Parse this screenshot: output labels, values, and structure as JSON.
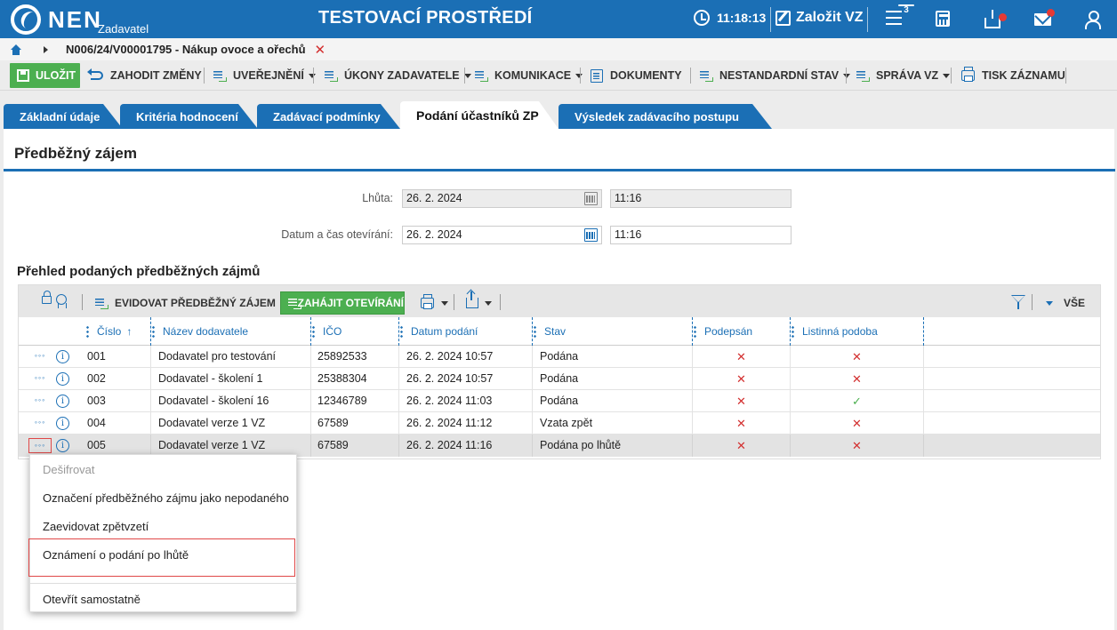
{
  "header": {
    "logo_text": "NEN",
    "logo_sub": "Zadavatel",
    "environment_title": "TESTOVACÍ PROSTŘEDÍ",
    "clock": "11:18:13",
    "create_vz_label": "Založit VZ",
    "notifications_count": "3",
    "colors": {
      "primary": "#1b6fb5",
      "badge": "#e53935"
    }
  },
  "breadcrumb": {
    "path": "N006/24/V00001795 - Nákup ovoce a ořechů"
  },
  "toolbar": {
    "save": "ULOŽIT",
    "discard": "ZAHODIT ZMĚNY",
    "publish": "UVEŘEJNĚNÍ",
    "actions": "ÚKONY ZADAVATELE",
    "communication": "KOMUNIKACE",
    "documents": "DOKUMENTY",
    "nonstandard": "NESTANDARDNÍ STAV",
    "management": "SPRÁVA VZ",
    "print": "TISK ZÁZNAMU"
  },
  "tabs": [
    {
      "label": "Základní údaje",
      "active": false
    },
    {
      "label": "Kritéria hodnocení",
      "active": false
    },
    {
      "label": "Zadávací podmínky",
      "active": false
    },
    {
      "label": "Podání účastníků ZP",
      "active": true
    },
    {
      "label": "Výsledek zadávacího postupu",
      "active": false
    }
  ],
  "panel": {
    "title": "Předběžný zájem",
    "deadline_label": "Lhůta:",
    "deadline_date": "26. 2. 2024",
    "deadline_time": "11:16",
    "opening_label": "Datum a čas otevírání:",
    "opening_date": "26. 2. 2024",
    "opening_time": "11:16"
  },
  "grid": {
    "title": "Přehled podaných předběžných zájmů",
    "toolbar": {
      "register": "EVIDOVAT PŘEDBĚŽNÝ ZÁJEM",
      "start_opening": "ZAHÁJIT OTEVÍRÁNÍ",
      "all": "VŠE"
    },
    "columns": {
      "number": "Číslo",
      "supplier": "Název dodavatele",
      "ico": "IČO",
      "date": "Datum podání",
      "state": "Stav",
      "signed": "Podepsán",
      "paper": "Listinná podoba"
    },
    "more_glyph": "◦◦◦",
    "info_glyph": "i",
    "rows": [
      {
        "number": "001",
        "supplier": "Dodavatel pro testování",
        "ico": "25892533",
        "date": "26. 2. 2024 10:57",
        "state": "Podána",
        "signed": "✕",
        "paper": "✕"
      },
      {
        "number": "002",
        "supplier": "Dodavatel - školení 1",
        "ico": "25388304",
        "date": "26. 2. 2024 10:57",
        "state": "Podána",
        "signed": "✕",
        "paper": "✕"
      },
      {
        "number": "003",
        "supplier": "Dodavatel - školení 16",
        "ico": "12346789",
        "date": "26. 2. 2024 11:03",
        "state": "Podána",
        "signed": "✕",
        "paper": "✓"
      },
      {
        "number": "004",
        "supplier": "Dodavatel verze 1 VZ",
        "ico": "67589",
        "date": "26. 2. 2024 11:12",
        "state": "Vzata zpět",
        "signed": "✕",
        "paper": "✕"
      },
      {
        "number": "005",
        "supplier": "Dodavatel verze 1 VZ",
        "ico": "67589",
        "date": "26. 2. 2024 11:16",
        "state": "Podána po lhůtě",
        "signed": "✕",
        "paper": "✕"
      }
    ]
  },
  "context_menu": {
    "items": [
      {
        "label": "Dešifrovat",
        "disabled": true
      },
      {
        "label": "Označení předběžného zájmu jako nepodaného",
        "disabled": false
      },
      {
        "label": "Zaevidovat zpětvzetí",
        "disabled": false
      },
      {
        "label": "Oznámení o podání po lhůtě",
        "disabled": false
      },
      {
        "label": "Otevřít samostatně",
        "disabled": false
      }
    ]
  }
}
